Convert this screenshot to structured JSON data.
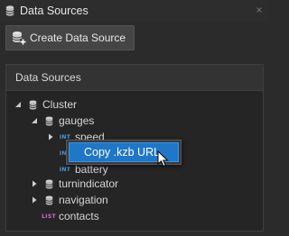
{
  "window": {
    "title": "Data Sources",
    "close_glyph": "×"
  },
  "toolbar": {
    "create_label": "Create Data Source"
  },
  "panel": {
    "header": "Data Sources"
  },
  "tree": {
    "cluster": "Cluster",
    "gauges": "gauges",
    "speed": "speed",
    "battery": "battery",
    "turnindicator": "turnindicator",
    "navigation": "navigation",
    "contacts": "contacts"
  },
  "badges": {
    "int": "INT",
    "list": "LIST"
  },
  "context_menu": {
    "items": [
      "Copy .kzb URL"
    ]
  },
  "colors": {
    "accent": "#1f77c8",
    "int_badge": "#4a9ae0",
    "list_badge": "#d36cd0"
  },
  "icons": [
    "database-icon",
    "database-add-icon",
    "close-icon",
    "chevron-down-icon",
    "chevron-right-icon",
    "mouse-pointer-icon"
  ]
}
